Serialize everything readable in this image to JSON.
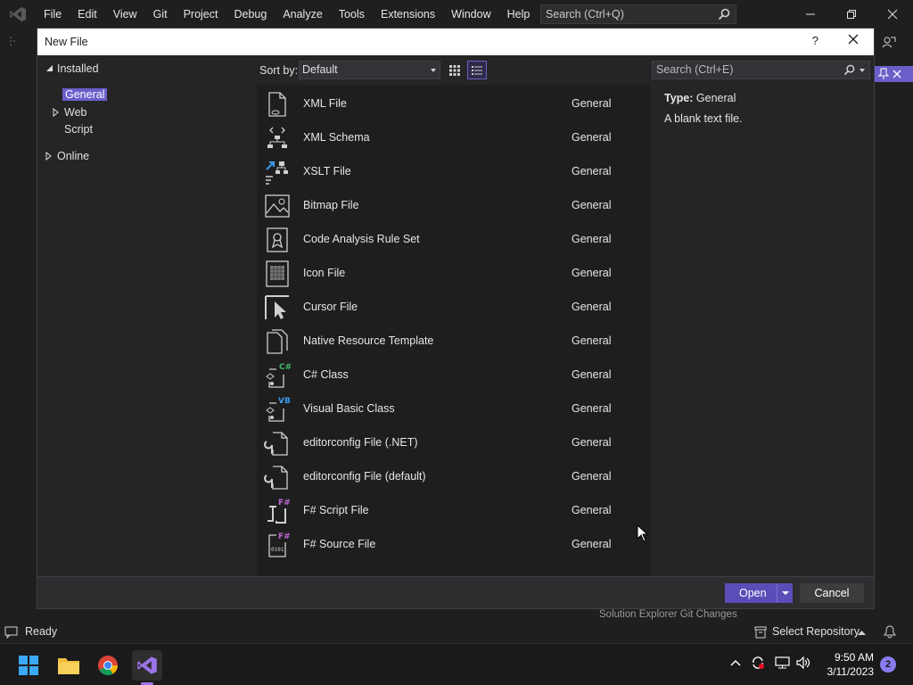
{
  "menubar": {
    "items": [
      "File",
      "Edit",
      "View",
      "Git",
      "Project",
      "Debug",
      "Analyze",
      "Tools",
      "Extensions",
      "Window",
      "Help"
    ],
    "search_placeholder": "Search (Ctrl+Q)"
  },
  "dialog": {
    "title": "New File",
    "help": "?",
    "tree": {
      "installed": "Installed",
      "general": "General",
      "web": "Web",
      "script": "Script",
      "online": "Online"
    },
    "sort_label": "Sort by:",
    "sort_value": "Default",
    "search_placeholder": "Search (Ctrl+E)",
    "templates": [
      {
        "name": "XML File",
        "category": "General",
        "icon": "xml-file-icon"
      },
      {
        "name": "XML Schema",
        "category": "General",
        "icon": "xml-schema-icon"
      },
      {
        "name": "XSLT File",
        "category": "General",
        "icon": "xslt-file-icon"
      },
      {
        "name": "Bitmap File",
        "category": "General",
        "icon": "bitmap-file-icon"
      },
      {
        "name": "Code Analysis Rule Set",
        "category": "General",
        "icon": "rule-set-icon"
      },
      {
        "name": "Icon File",
        "category": "General",
        "icon": "icon-file-icon"
      },
      {
        "name": "Cursor File",
        "category": "General",
        "icon": "cursor-file-icon"
      },
      {
        "name": "Native Resource Template",
        "category": "General",
        "icon": "resource-template-icon"
      },
      {
        "name": "C# Class",
        "category": "General",
        "icon": "csharp-class-icon"
      },
      {
        "name": "Visual Basic Class",
        "category": "General",
        "icon": "vb-class-icon"
      },
      {
        "name": "editorconfig File (.NET)",
        "category": "General",
        "icon": "editorconfig-icon"
      },
      {
        "name": "editorconfig File (default)",
        "category": "General",
        "icon": "editorconfig-icon"
      },
      {
        "name": "F# Script File",
        "category": "General",
        "icon": "fsharp-script-icon"
      },
      {
        "name": "F# Source File",
        "category": "General",
        "icon": "fsharp-source-icon"
      }
    ],
    "details": {
      "type_label": "Type:",
      "type_value": "General",
      "description": "A blank text file."
    },
    "open_label": "Open",
    "cancel_label": "Cancel"
  },
  "background": {
    "se_tabs": "Solution Explorer   Git Changes"
  },
  "statusbar": {
    "ready": "Ready",
    "repo": "Select Repository"
  },
  "taskbar": {
    "time": "9:50 AM",
    "date": "3/11/2023",
    "notifications": "2"
  },
  "colors": {
    "accent": "#6a5fc9",
    "open_button": "#5a4db8",
    "background": "#1f1f1f"
  }
}
